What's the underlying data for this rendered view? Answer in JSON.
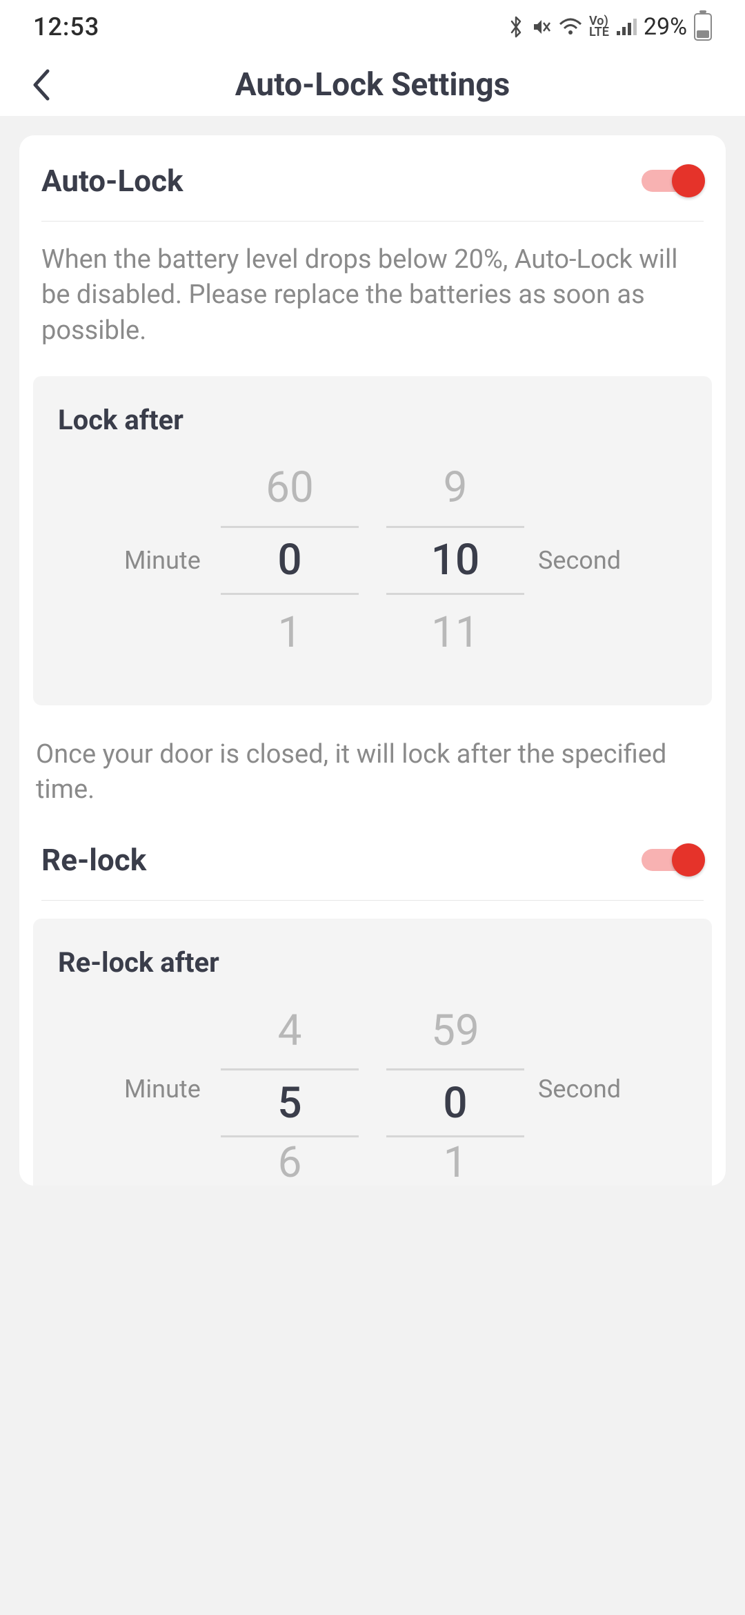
{
  "status": {
    "time": "12:53",
    "battery_pct": "29%"
  },
  "header": {
    "title": "Auto-Lock Settings"
  },
  "autolock": {
    "label": "Auto-Lock",
    "enabled": true,
    "warning": "When the battery level drops below 20%, Auto-Lock will be disabled. Please replace the batteries as soon as possible.",
    "lock_after": {
      "title": "Lock after",
      "minute_label": "Minute",
      "second_label": "Second",
      "minute_prev": "60",
      "minute_selected": "0",
      "minute_next": "1",
      "second_prev": "9",
      "second_selected": "10",
      "second_next": "11"
    },
    "lock_after_desc": "Once your door is closed, it will lock after the specified time."
  },
  "relock": {
    "label": "Re-lock",
    "enabled": true,
    "relock_after": {
      "title": "Re-lock after",
      "minute_label": "Minute",
      "second_label": "Second",
      "minute_prev": "4",
      "minute_selected": "5",
      "minute_next": "6",
      "second_prev": "59",
      "second_selected": "0",
      "second_next": "1"
    }
  }
}
